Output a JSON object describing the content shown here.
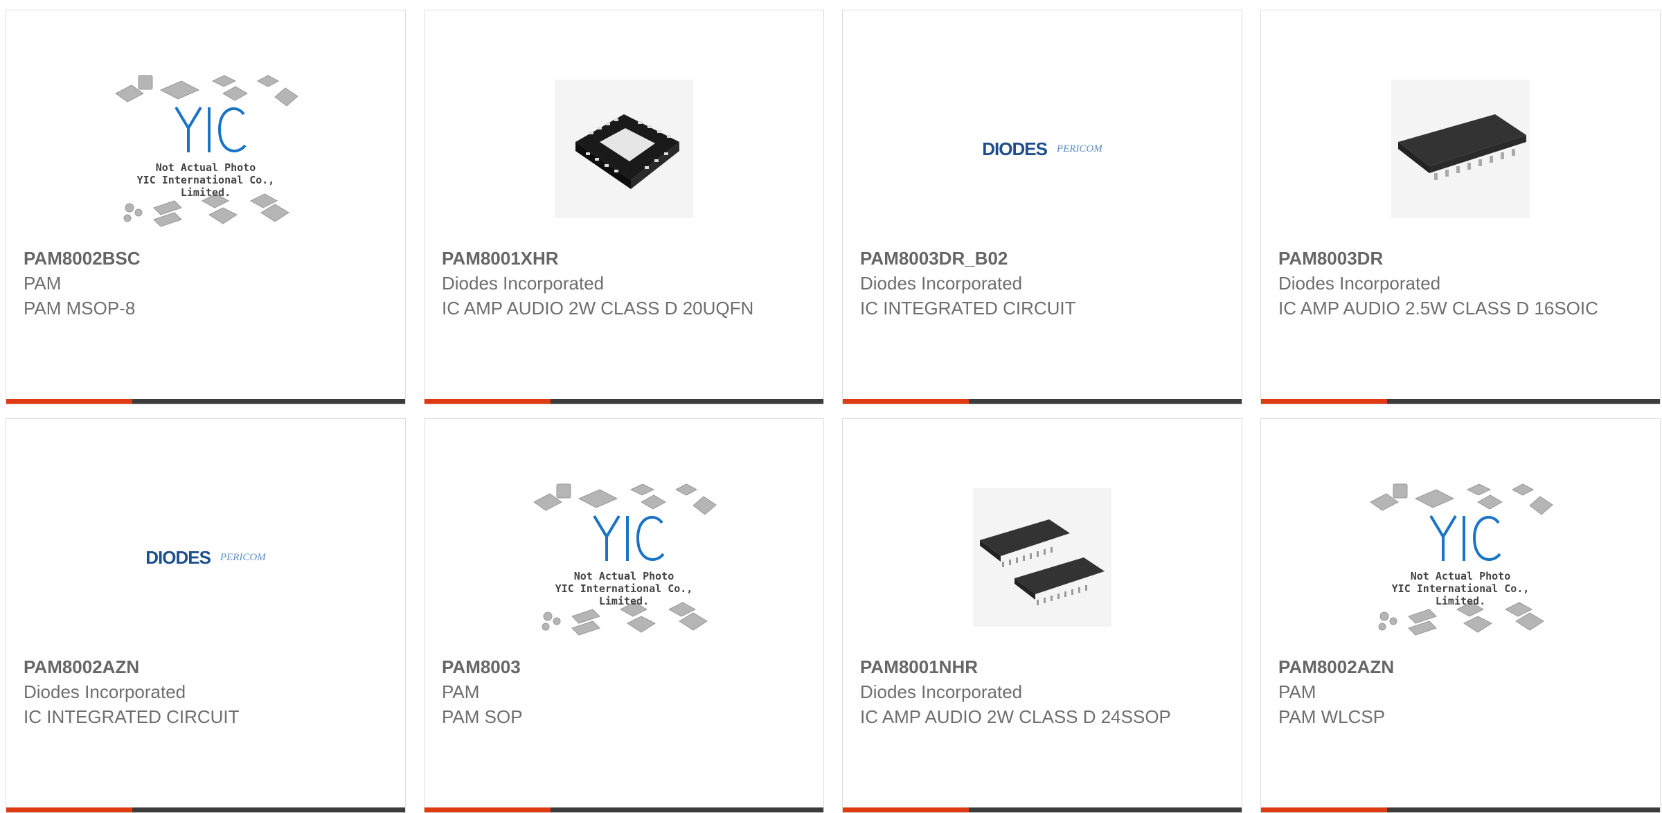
{
  "cards": [
    {
      "part": "PAM8002BSC",
      "maker": "PAM",
      "desc": "PAM MSOP-8",
      "image": "yic-placeholder"
    },
    {
      "part": "PAM8001XHR",
      "maker": "Diodes Incorporated",
      "desc": "IC AMP AUDIO 2W CLASS D 20UQFN",
      "image": "qfn-chip"
    },
    {
      "part": "PAM8003DR_B02",
      "maker": "Diodes Incorporated",
      "desc": "IC INTEGRATED CIRCUIT",
      "image": "diodes-pericom-logo"
    },
    {
      "part": "PAM8003DR",
      "maker": "Diodes Incorporated",
      "desc": "IC AMP AUDIO 2.5W CLASS D 16SOIC",
      "image": "soic-chip"
    },
    {
      "part": "PAM8002AZN",
      "maker": "Diodes Incorporated",
      "desc": "IC INTEGRATED CIRCUIT",
      "image": "diodes-pericom-logo"
    },
    {
      "part": "PAM8003",
      "maker": "PAM",
      "desc": "PAM SOP",
      "image": "yic-placeholder"
    },
    {
      "part": "PAM8001NHR",
      "maker": "Diodes Incorporated",
      "desc": "IC AMP AUDIO 2W CLASS D 24SSOP",
      "image": "ssop-chips"
    },
    {
      "part": "PAM8002AZN",
      "maker": "PAM",
      "desc": "PAM WLCSP",
      "image": "yic-placeholder"
    }
  ],
  "placeholder": {
    "caption_line1": "Not Actual Photo",
    "caption_line2": "YIC International Co., Limited.",
    "logo_text": "YIC"
  },
  "logos": {
    "diodes": "DIODES",
    "pericom": "PERICOM"
  },
  "colors": {
    "accent": "#e03a13",
    "bar": "#3c3c3c",
    "text": "#666666",
    "border": "#dcdcdc"
  }
}
